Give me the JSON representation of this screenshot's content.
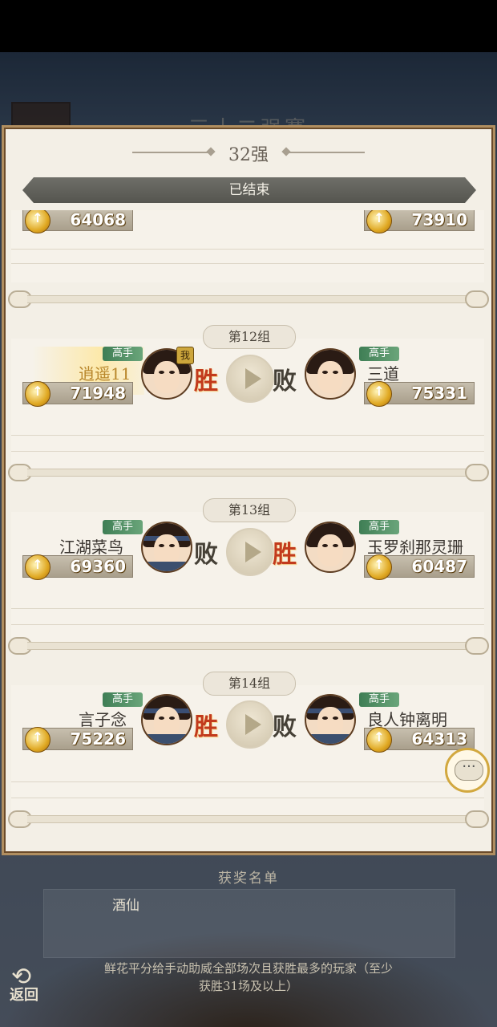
{
  "background_title": "三十二强赛",
  "panel": {
    "title": "32强",
    "status": "已结束"
  },
  "partial_row": {
    "left_power": "64068",
    "right_power": "73910"
  },
  "matches": [
    {
      "group": "第12组",
      "left": {
        "rank": "高手",
        "name": "逍遥11",
        "power": "71948",
        "result": "胜",
        "is_me": true,
        "me_label": "我"
      },
      "right": {
        "rank": "高手",
        "name": "三道",
        "power": "75331",
        "result": "败"
      }
    },
    {
      "group": "第13组",
      "left": {
        "rank": "高手",
        "name": "江湖菜鸟",
        "power": "69360",
        "result": "败"
      },
      "right": {
        "rank": "高手",
        "name": "玉罗刹那灵珊",
        "power": "60487",
        "result": "胜"
      }
    },
    {
      "group": "第14组",
      "left": {
        "rank": "高手",
        "name": "言子念",
        "power": "75226",
        "result": "胜"
      },
      "right": {
        "rank": "高手",
        "name": "良人钟离明",
        "power": "64313",
        "result": "败"
      }
    }
  ],
  "footer": {
    "title": "获奖名单",
    "winner": "酒仙",
    "note": "鲜花平分给手动助威全部场次且获胜最多的玩家（至少获胜31场及以上）"
  },
  "back_label": "返回",
  "icons": {
    "coin": "power-coin-icon",
    "play": "play-icon",
    "chat": "chat-icon",
    "back": "back-arrow-icon"
  }
}
